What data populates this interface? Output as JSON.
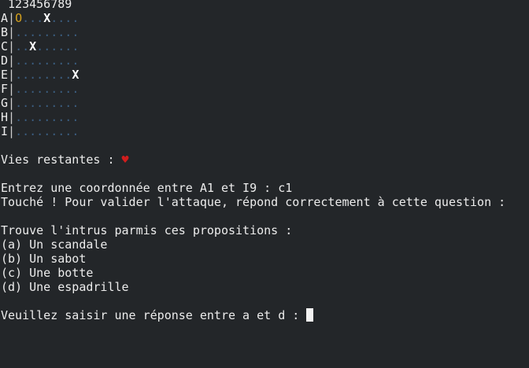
{
  "board": {
    "col_header": " 123456789",
    "rows": [
      {
        "label": "A",
        "sep": "|",
        "cells": [
          "O",
          ".",
          ".",
          ".",
          "X",
          ".",
          ".",
          ".",
          "."
        ]
      },
      {
        "label": "B",
        "sep": "|",
        "cells": [
          ".",
          ".",
          ".",
          ".",
          ".",
          ".",
          ".",
          ".",
          "."
        ]
      },
      {
        "label": "C",
        "sep": "|",
        "cells": [
          ".",
          ".",
          "X",
          ".",
          ".",
          ".",
          ".",
          ".",
          "."
        ]
      },
      {
        "label": "D",
        "sep": "|",
        "cells": [
          ".",
          ".",
          ".",
          ".",
          ".",
          ".",
          ".",
          ".",
          "."
        ]
      },
      {
        "label": "E",
        "sep": "|",
        "cells": [
          ".",
          ".",
          ".",
          ".",
          ".",
          ".",
          ".",
          ".",
          "X"
        ]
      },
      {
        "label": "F",
        "sep": "|",
        "cells": [
          ".",
          ".",
          ".",
          ".",
          ".",
          ".",
          ".",
          ".",
          "."
        ]
      },
      {
        "label": "G",
        "sep": "|",
        "cells": [
          ".",
          ".",
          ".",
          ".",
          ".",
          ".",
          ".",
          ".",
          "."
        ]
      },
      {
        "label": "H",
        "sep": "|",
        "cells": [
          ".",
          ".",
          ".",
          ".",
          ".",
          ".",
          ".",
          ".",
          "."
        ]
      },
      {
        "label": "I",
        "sep": "|",
        "cells": [
          ".",
          ".",
          ".",
          ".",
          ".",
          ".",
          ".",
          ".",
          "."
        ]
      }
    ]
  },
  "lives": {
    "label": "Vies restantes : ",
    "heart": "♥"
  },
  "prompt_coord": "Entrez une coordonnée entre A1 et I9 : c1",
  "hit_message": "Touché ! Pour valider l'attaque, répond correctement à cette question :",
  "question": {
    "title": "Trouve l'intrus parmis ces propositions :",
    "options": [
      "(a) Un scandale",
      "(b) Un sabot",
      "(c) Une botte",
      "(d) Une espadrille"
    ]
  },
  "answer_prompt": "Veuillez saisir une réponse entre a et d : ",
  "colors": {
    "background": "#232629",
    "text": "#ececec",
    "grid_dot": "#3b5d80",
    "miss_marker": "#d6a21e",
    "heart": "#d11d1d"
  }
}
